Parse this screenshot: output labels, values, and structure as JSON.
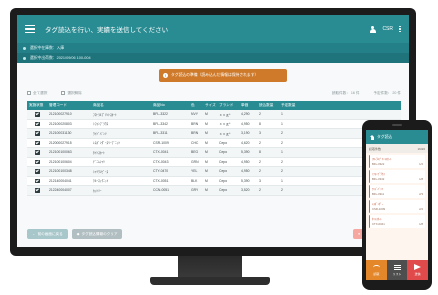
{
  "app": {
    "title": "タグ読込を行い、実績を送信してください",
    "user": "CSR"
  },
  "sub": {
    "line1": "選択中在庫数：入庫",
    "line2": "選択中出荷数：2021/09/06 100-004"
  },
  "notice": {
    "text": "タグ読込の準備（読み込んだ情報は保持されます）"
  },
  "toolbar": {
    "select_all": "全て選択",
    "deselect_all": "選択解除",
    "count_label": "読取件数：",
    "count_value": "16 件",
    "planned_label": "予定件数：",
    "planned_value": "20 件"
  },
  "table": {
    "headers": [
      "実施状態",
      "管理コード",
      "商品名",
      "商品No",
      "色",
      "サイズ",
      "ブランド",
      "単価",
      "読込数量",
      "予定数量",
      ""
    ],
    "rows": [
      [
        "212100027910",
        "ﾌﾛｰﾗﾙﾌﾟﾘﾝﾄｽｶｰﾄ",
        "BFL-3322",
        "NVY",
        "M",
        "ｘｘｇ*",
        "4,290",
        "2",
        "1"
      ],
      [
        "212100020803",
        "ｼﾌｫﾝﾌﾞﾗｳｽ",
        "BFL-3342",
        "BRN",
        "M",
        "ｘｘｇ*",
        "4,950",
        "8",
        "1"
      ],
      [
        "212100031130",
        "ﾜｲﾄﾞﾊﾟﾝﾂ",
        "BFL-3311",
        "BRN",
        "M",
        "ｘｘｇ*",
        "3,190",
        "3",
        "2"
      ],
      [
        "212000027915",
        "ﾚｽﾎﾞﾝﾀﾞｰｽﾘｰﾌﾞﾆｯﾄ",
        "CSR-1009",
        "CHC",
        "M",
        "Cepo",
        "4,620",
        "2",
        "2"
      ],
      [
        "212100100063",
        "ﾀｲﾄｽｶｰﾄ",
        "CTX-0041",
        "BEG",
        "M",
        "Cepo",
        "5,390",
        "8",
        "1"
      ],
      [
        "212100100604",
        "ﾃﾞﾆﾑｼｬﾂ",
        "CTX-0043",
        "GRN",
        "M",
        "Cepo",
        "4,950",
        "2",
        "2"
      ],
      [
        "212100100348",
        "ｼｬﾂﾜﾝﾋﾟｰｽ",
        "CTY-0470",
        "YEL",
        "M",
        "Cepo",
        "4,950",
        "2",
        "2"
      ],
      [
        "212140004041",
        "ｸﾙｰﾈｯｸﾆｯﾄ",
        "CTX-0051",
        "BLK",
        "M",
        "Cepo",
        "5,390",
        "3",
        "1"
      ],
      [
        "212240004007",
        "ｶｯﾄｿｰ",
        "CCN-0051",
        "GRY",
        "M",
        "Cepo",
        "3,520",
        "2",
        "2"
      ]
    ]
  },
  "buttons": {
    "back": "前の画面に戻る",
    "tag_clear": "タグ読込情報のクリア",
    "send": "送信"
  },
  "phone": {
    "title": "タグ読込",
    "sub_left": "読取件数",
    "sub_right": "16/20",
    "cards": [
      {
        "name": "ﾌﾛｰﾗﾙﾌﾟﾘﾝﾄｽｶｰﾄ",
        "code": "BFL-3322",
        "qty": "1/2"
      },
      {
        "name": "ｼﾌｫﾝﾌﾞﾗｳｽ",
        "code": "BFL-3342",
        "qty": "1/8"
      },
      {
        "name": "ﾜｲﾄﾞﾊﾟﾝﾂ",
        "code": "BFL-3311",
        "qty": "2/3"
      },
      {
        "name": "ﾚｽﾎﾞﾝﾀﾞｰ",
        "code": "CSR-1009",
        "qty": "2/2"
      },
      {
        "name": "ﾀｲﾄｽｶｰﾄ",
        "code": "CTX-0041",
        "qty": "1/8"
      }
    ],
    "foot": [
      "読取",
      "リスト",
      "送信"
    ]
  }
}
